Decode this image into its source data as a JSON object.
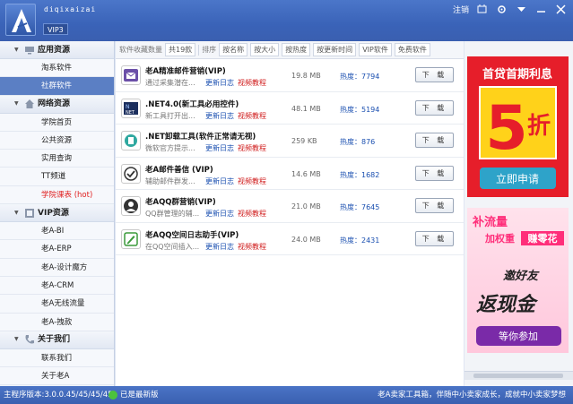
{
  "app": {
    "name": "diqixaizai",
    "badge": "VIP3"
  },
  "window": {
    "logout": "注销"
  },
  "sidebar": {
    "sections": [
      {
        "title": "应用资源",
        "icon": "monitor-icon",
        "items": [
          {
            "label": "淘系软件"
          },
          {
            "label": "社群软件"
          }
        ]
      },
      {
        "title": "网络资源",
        "icon": "home-icon",
        "items": [
          {
            "label": "学院首页"
          },
          {
            "label": "公共资源"
          },
          {
            "label": "实用查询"
          },
          {
            "label": "TT频道"
          },
          {
            "label": "学院课表 (hot)"
          }
        ]
      },
      {
        "title": "VIP资源",
        "icon": "vip-icon",
        "items": [
          {
            "label": "老A-BI"
          },
          {
            "label": "老A-ERP"
          },
          {
            "label": "老A-设计魔方"
          },
          {
            "label": "老A-CRM"
          },
          {
            "label": "老A无线流量"
          },
          {
            "label": "老A-拽款"
          }
        ]
      },
      {
        "title": "关于我们",
        "icon": "phone-icon",
        "items": [
          {
            "label": "联系我们"
          },
          {
            "label": "关于老A"
          }
        ]
      }
    ]
  },
  "toolbar": {
    "label": "软件收藏数量",
    "count": "共19款",
    "sort_label": "排序",
    "buttons": [
      "按名称",
      "按大小",
      "按热度",
      "按更新时间",
      "VIP软件",
      "免费软件"
    ]
  },
  "list": {
    "download_label": "下 载",
    "changelog_label": "更新日志",
    "video_label": "视频教程",
    "heat_prefix": "热度：",
    "rows": [
      {
        "title": "老A精准邮件营销(VIP)",
        "desc": "通过采集潜在...",
        "size": "19.8 MB",
        "heat": "7794",
        "icon": "email-marketing-icon"
      },
      {
        "title": ".NET4.0(新工具必用控件)",
        "desc": "新工具打开出...",
        "size": "48.1 MB",
        "heat": "5194",
        "icon": "dotnet-icon"
      },
      {
        "title": ".NET卸载工具(软件正常请无视)",
        "desc": "微软官方提示...",
        "size": "259 KB",
        "heat": "876",
        "icon": "uninstall-icon"
      },
      {
        "title": "老A邮件善信 (VIP)",
        "desc": "辅助邮件群发...",
        "size": "14.6 MB",
        "heat": "1682",
        "icon": "checkmark-icon"
      },
      {
        "title": "老AQQ群营销(VIP)",
        "desc": "QQ群管理的辅...",
        "size": "21.0 MB",
        "heat": "7645",
        "icon": "qq-user-icon"
      },
      {
        "title": "老AQQ空间日志助手(VIP)",
        "desc": "在QQ空间插入...",
        "size": "24.0 MB",
        "heat": "2431",
        "icon": "edit-icon"
      }
    ]
  },
  "ads": {
    "ad1": {
      "line1": "首贷首期利息",
      "big": "5",
      "unit": "折",
      "button": "立即申请"
    },
    "ad2": {
      "line1": "补流量",
      "line2": "加权重",
      "line3": "赚零花",
      "line4": "邀好友",
      "line5": "返现金",
      "button": "等你参加"
    }
  },
  "status": {
    "version": "主程序版本:3.0.0.45/45/45/45",
    "latest": "已是最新版",
    "slogan": "老A卖家工具箱，伴随中小卖家成长，成就中小卖家梦想"
  },
  "colors": {
    "titlebar": "#3a63b8",
    "active": "#5b7fc4",
    "adRed": "#e61e2a",
    "link": "#1a4fb0",
    "video": "#d01c1c"
  }
}
